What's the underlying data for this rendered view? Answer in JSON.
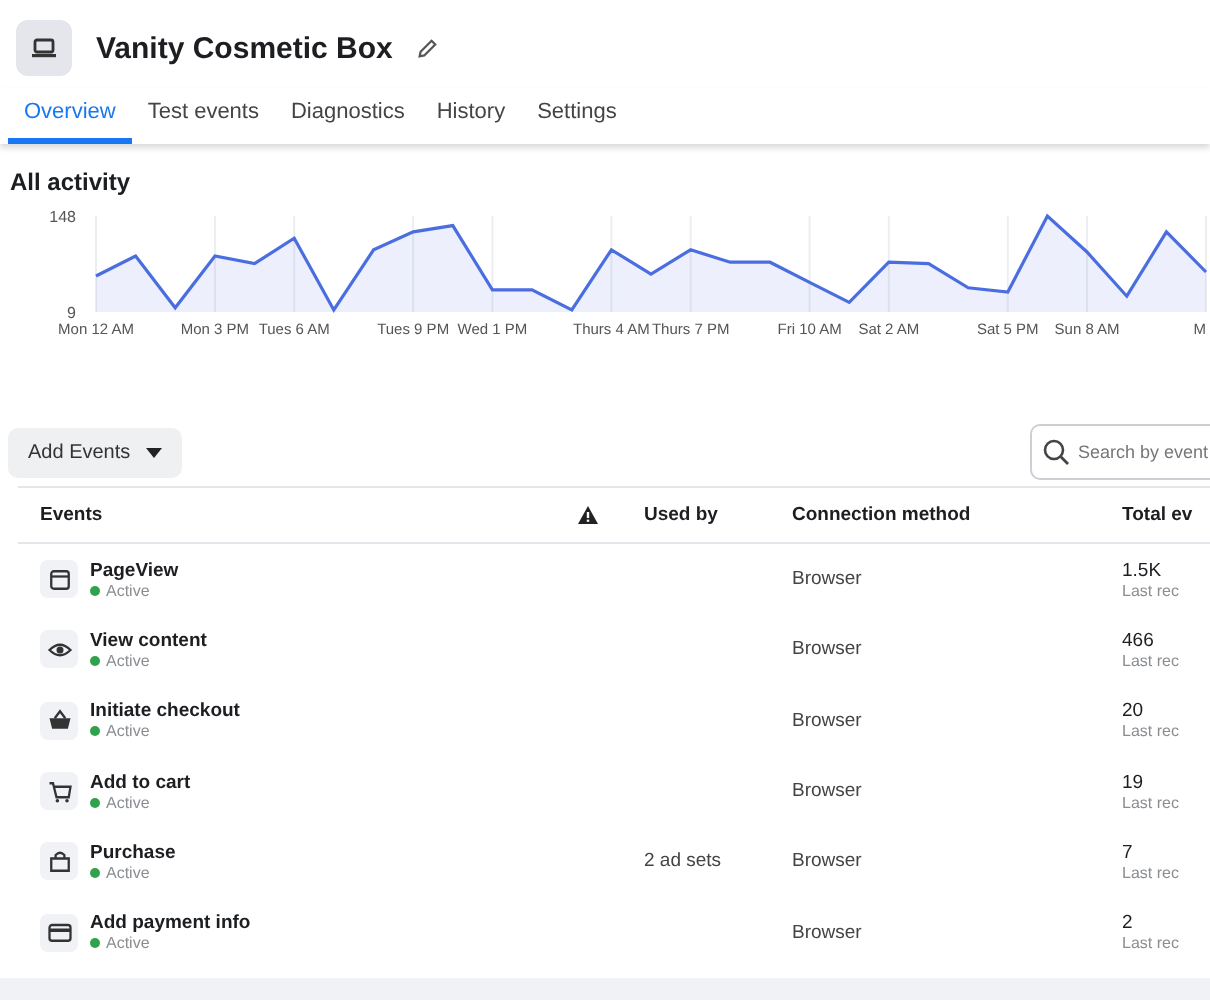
{
  "header": {
    "title": "Vanity Cosmetic Box"
  },
  "tabs": [
    {
      "label": "Overview",
      "selected": true
    },
    {
      "label": "Test events",
      "selected": false
    },
    {
      "label": "Diagnostics",
      "selected": false
    },
    {
      "label": "History",
      "selected": false
    },
    {
      "label": "Settings",
      "selected": false
    }
  ],
  "activity": {
    "title": "All activity",
    "chart_data": {
      "type": "area",
      "categories": [
        "Mon 12 AM",
        null,
        null,
        "Mon 3 PM",
        null,
        "Tues 6 AM",
        null,
        null,
        "Tues 9 PM",
        null,
        "Wed 1 PM",
        null,
        null,
        "Thurs 4 AM",
        null,
        "Thurs 7 PM",
        null,
        null,
        "Fri 10 AM",
        null,
        "Sat 2 AM",
        null,
        null,
        "Sat 5 PM",
        null,
        "Sun 8 AM",
        null,
        null,
        "M"
      ],
      "series": [
        {
          "color": "#4a6ee0",
          "values": [
            61,
            90,
            15,
            90,
            79,
            116,
            12,
            99,
            125,
            134,
            41,
            41,
            12,
            99,
            64,
            99,
            81,
            81,
            52,
            23,
            81,
            79,
            44,
            38,
            148,
            96,
            32,
            125,
            67
          ]
        }
      ],
      "ylim": [
        9,
        148
      ],
      "yticks": [
        9,
        148
      ],
      "grid": true
    }
  },
  "toolbar": {
    "add_button": "Add Events",
    "search": {
      "placeholder": "Search by event"
    }
  },
  "table": {
    "columns": [
      "Events",
      "Used by",
      "Connection method",
      "Total ev"
    ],
    "rows": [
      {
        "kind": "browser",
        "name": "PageView",
        "status": "Active",
        "used_by": "",
        "method": "Browser",
        "total": "1.5K",
        "sub": "Last rec"
      },
      {
        "kind": "eye",
        "name": "View content",
        "status": "Active",
        "used_by": "",
        "method": "Browser",
        "total": "466",
        "sub": "Last rec"
      },
      {
        "kind": "basket",
        "name": "Initiate checkout",
        "status": "Active",
        "used_by": "",
        "method": "Browser",
        "total": "20",
        "sub": "Last rec"
      },
      {
        "kind": "cart",
        "name": "Add to cart",
        "status": "Active",
        "used_by": "",
        "method": "Browser",
        "total": "19",
        "sub": "Last rec"
      },
      {
        "kind": "bag",
        "name": "Purchase",
        "status": "Active",
        "used_by": "2 ad sets",
        "method": "Browser",
        "total": "7",
        "sub": "Last rec"
      },
      {
        "kind": "card",
        "name": "Add payment info",
        "status": "Active",
        "used_by": "",
        "method": "Browser",
        "total": "2",
        "sub": "Last rec"
      }
    ]
  }
}
